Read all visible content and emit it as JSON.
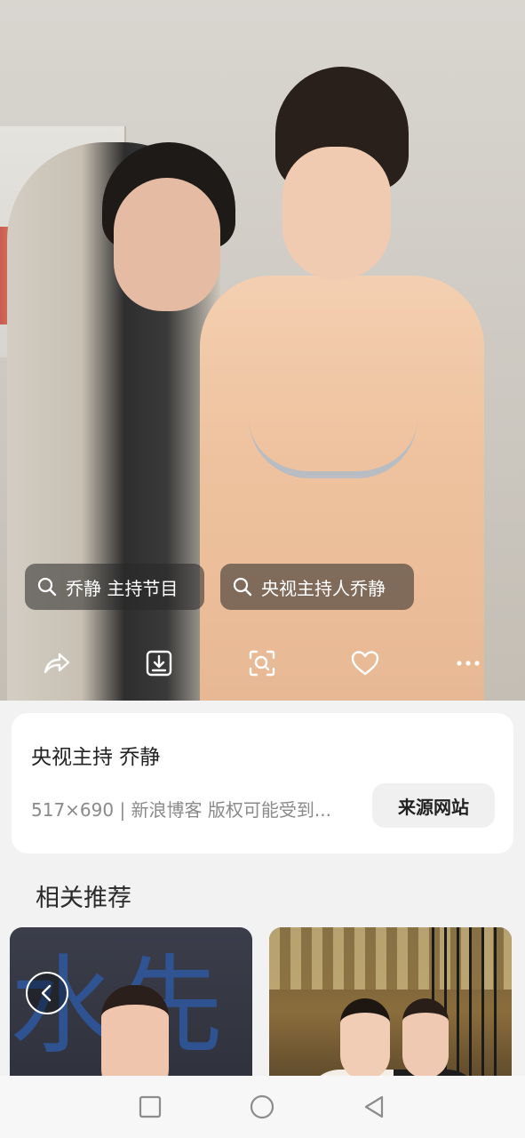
{
  "search_chips": [
    {
      "label": "乔静 主持节目"
    },
    {
      "label": "央视主持人乔静"
    }
  ],
  "actions": {
    "share_icon": "share-icon",
    "download_icon": "download-icon",
    "visual_search_icon": "scan-search-icon",
    "favorite_icon": "heart-icon",
    "more_icon": "more-dots-icon"
  },
  "info": {
    "title": "央视主持 乔静",
    "meta": "517×690 | 新浪博客 版权可能受到...",
    "source_button": "来源网站"
  },
  "related": {
    "title": "相关推荐",
    "thumb1_bg_text": "水先"
  },
  "colors": {
    "page_background": "#f2f2f2",
    "card_background": "#ffffff",
    "chip_background": "rgba(40,40,40,0.55)"
  }
}
